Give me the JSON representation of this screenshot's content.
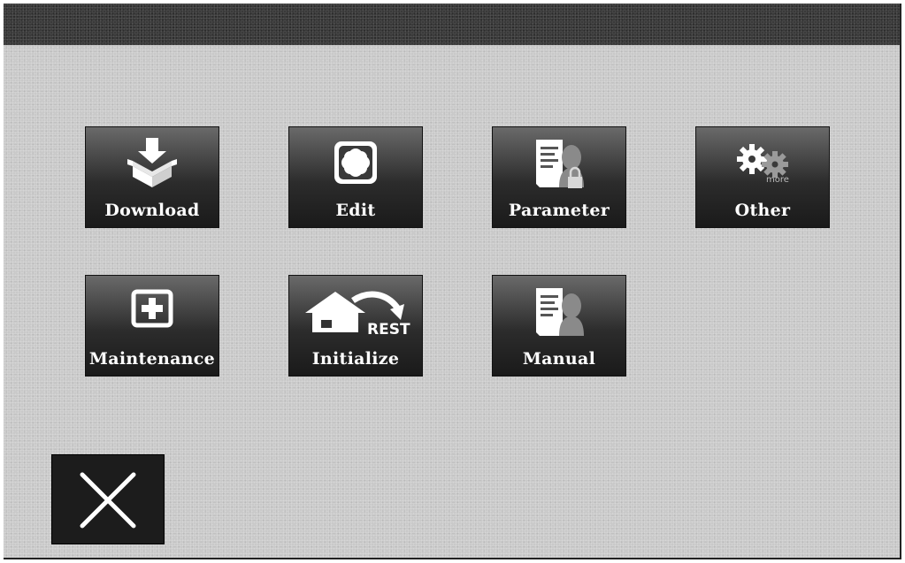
{
  "menu": {
    "tiles": [
      {
        "label": "Download",
        "icon": "download-icon"
      },
      {
        "label": "Edit",
        "icon": "edit-icon"
      },
      {
        "label": "Parameter",
        "icon": "parameter-icon"
      },
      {
        "label": "Other",
        "icon": "gears-more-icon"
      },
      {
        "label": "Maintenance",
        "icon": "plus-box-icon"
      },
      {
        "label": "Initialize",
        "icon": "house-reset-icon",
        "icon_text": "REST"
      },
      {
        "label": "Manual",
        "icon": "manual-icon"
      }
    ],
    "other_icon_text": "more"
  },
  "close_button": {
    "icon": "close-icon"
  },
  "colors": {
    "background": "#c9c9c9",
    "titlebar": "#3a3a3a",
    "tile_top": "#6a6a6a",
    "tile_bottom": "#1a1a1a",
    "label": "#ffffff"
  }
}
